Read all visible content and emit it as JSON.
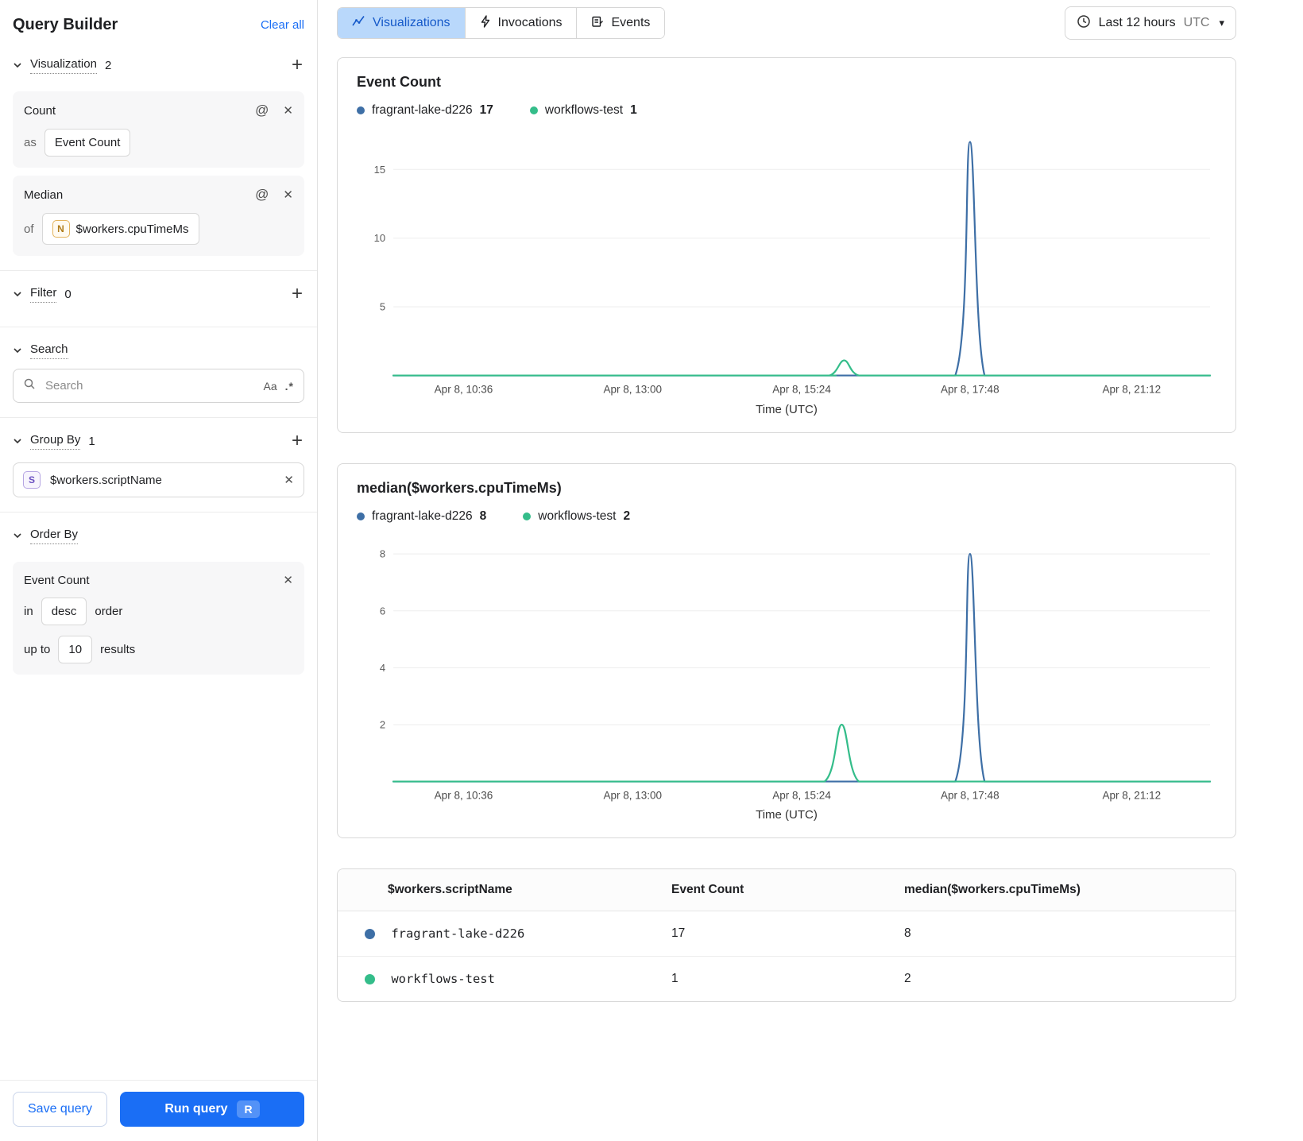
{
  "colors": {
    "accent": "#1a6ef5",
    "tab_selected_bg": "#b9d8fb",
    "series_blue": "#3e6fa6",
    "series_green": "#34bd8a"
  },
  "icons": {
    "plus": "+",
    "close": "✕",
    "at": "@",
    "match_case": "Aa",
    "regex": ".*",
    "caret_down": "▾",
    "n_badge": "N",
    "s_badge": "S"
  },
  "sidebar": {
    "title": "Query Builder",
    "clear_all": "Clear all",
    "visualization": {
      "label": "Visualization",
      "count": "2",
      "cards": [
        {
          "title": "Count",
          "prefix": "as",
          "value": "Event Count"
        },
        {
          "title": "Median",
          "prefix": "of",
          "value": "$workers.cpuTimeMs"
        }
      ]
    },
    "filter": {
      "label": "Filter",
      "count": "0"
    },
    "search": {
      "label": "Search",
      "placeholder": "Search"
    },
    "group_by": {
      "label": "Group By",
      "count": "1",
      "items": [
        {
          "value": "$workers.scriptName"
        }
      ]
    },
    "order_by": {
      "label": "Order By",
      "card": {
        "title": "Event Count",
        "in_label": "in",
        "direction": "desc",
        "order_label": "order",
        "up_to_label": "up to",
        "limit": "10",
        "results_label": "results"
      }
    },
    "save_button": "Save query",
    "run_button": "Run query",
    "run_shortcut": "R"
  },
  "header": {
    "tabs": [
      {
        "label": "Visualizations",
        "selected": true
      },
      {
        "label": "Invocations",
        "selected": false
      },
      {
        "label": "Events",
        "selected": false
      }
    ],
    "time_range": {
      "label": "Last 12 hours",
      "timezone": "UTC"
    }
  },
  "chart_data": [
    {
      "type": "line",
      "title": "Event Count",
      "xlabel": "Time (UTC)",
      "ylabel": "",
      "ylim": [
        0,
        17.5
      ],
      "yticks": [
        5,
        10,
        15
      ],
      "xticks": [
        {
          "label": "Apr 8, 10:36",
          "pos": 0.086
        },
        {
          "label": "Apr 8, 13:00",
          "pos": 0.293
        },
        {
          "label": "Apr 8, 15:24",
          "pos": 0.5
        },
        {
          "label": "Apr 8, 17:48",
          "pos": 0.706
        },
        {
          "label": "Apr 8, 21:12",
          "pos": 0.904
        }
      ],
      "legend": [
        {
          "name": "fragrant-lake-d226",
          "value": 17,
          "color": "#3e6fa6"
        },
        {
          "name": "workflows-test",
          "value": 1,
          "color": "#34bd8a"
        }
      ],
      "series": [
        {
          "name": "fragrant-lake-d226",
          "color": "#3e6fa6",
          "points": [
            [
              0,
              0
            ],
            [
              0.6,
              0
            ],
            [
              0.688,
              0
            ],
            [
              0.706,
              17
            ],
            [
              0.724,
              0
            ],
            [
              0.78,
              0
            ],
            [
              1,
              0
            ]
          ]
        },
        {
          "name": "workflows-test",
          "color": "#34bd8a",
          "points": [
            [
              0,
              0
            ],
            [
              0.49,
              0
            ],
            [
              0.534,
              0
            ],
            [
              0.552,
              1.1
            ],
            [
              0.57,
              0
            ],
            [
              0.62,
              0
            ],
            [
              1,
              0
            ]
          ]
        }
      ]
    },
    {
      "type": "line",
      "title": "median($workers.cpuTimeMs)",
      "xlabel": "Time (UTC)",
      "ylabel": "",
      "ylim": [
        0,
        8.45
      ],
      "yticks": [
        2,
        4,
        6,
        8
      ],
      "xticks": [
        {
          "label": "Apr 8, 10:36",
          "pos": 0.086
        },
        {
          "label": "Apr 8, 13:00",
          "pos": 0.293
        },
        {
          "label": "Apr 8, 15:24",
          "pos": 0.5
        },
        {
          "label": "Apr 8, 17:48",
          "pos": 0.706
        },
        {
          "label": "Apr 8, 21:12",
          "pos": 0.904
        }
      ],
      "legend": [
        {
          "name": "fragrant-lake-d226",
          "value": 8,
          "color": "#3e6fa6"
        },
        {
          "name": "workflows-test",
          "value": 2,
          "color": "#34bd8a"
        }
      ],
      "series": [
        {
          "name": "fragrant-lake-d226",
          "color": "#3e6fa6",
          "points": [
            [
              0,
              0
            ],
            [
              0.6,
              0
            ],
            [
              0.688,
              0
            ],
            [
              0.706,
              8
            ],
            [
              0.724,
              0
            ],
            [
              0.78,
              0
            ],
            [
              1,
              0
            ]
          ]
        },
        {
          "name": "workflows-test",
          "color": "#34bd8a",
          "points": [
            [
              0,
              0
            ],
            [
              0.46,
              0
            ],
            [
              0.528,
              0
            ],
            [
              0.549,
              2
            ],
            [
              0.57,
              0
            ],
            [
              0.63,
              0
            ],
            [
              1,
              0
            ]
          ]
        }
      ]
    }
  ],
  "table": {
    "columns": [
      "$workers.scriptName",
      "Event Count",
      "median($workers.cpuTimeMs)"
    ],
    "rows": [
      {
        "dot_color": "#3e6fa6",
        "name": "fragrant-lake-d226",
        "event_count": "17",
        "median": "8"
      },
      {
        "dot_color": "#34bd8a",
        "name": "workflows-test",
        "event_count": "1",
        "median": "2"
      }
    ]
  }
}
